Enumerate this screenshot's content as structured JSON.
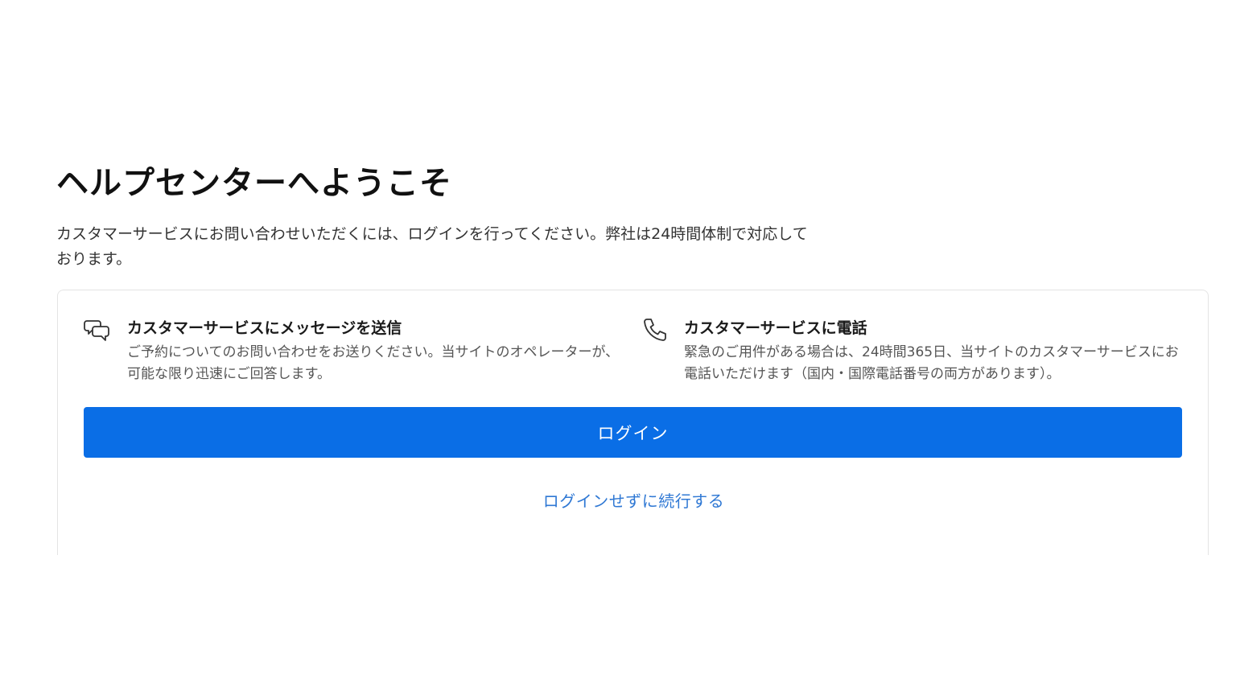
{
  "header": {
    "title": "ヘルプセンターへようこそ",
    "intro": "カスタマーサービスにお問い合わせいただくには、ログインを行ってください。弊社は24時間体制で対応しております。"
  },
  "card": {
    "options": [
      {
        "icon": "chat-bubbles-icon",
        "title": "カスタマーサービスにメッセージを送信",
        "description": "ご予約についてのお問い合わせをお送りください。当サイトのオペレーターが、可能な限り迅速にご回答します。"
      },
      {
        "icon": "phone-icon",
        "title": "カスタマーサービスに電話",
        "description": "緊急のご用件がある場合は、24時間365日、当サイトのカスタマーサービスにお電話いただけます（国内・国際電話番号の両方があります）。"
      }
    ],
    "login_label": "ログイン",
    "skip_label": "ログインせずに続行する"
  },
  "colors": {
    "primary": "#0a6ee6",
    "link": "#2f78d4",
    "border": "#e4e4e4"
  }
}
